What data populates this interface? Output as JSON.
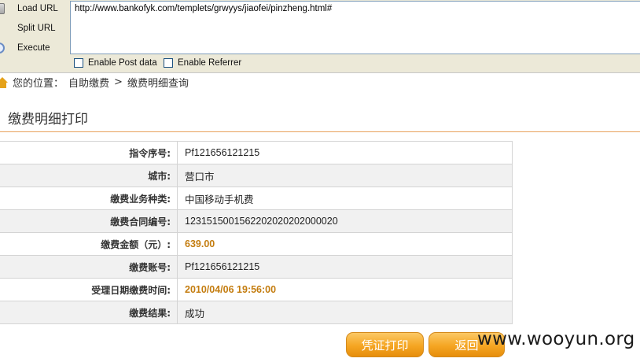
{
  "hackbar": {
    "load_url": "Load URL",
    "split_url": "Split URL",
    "execute": "Execute",
    "url_value": "http://www.bankofyk.com/templets/grwyys/jiaofei/pinzheng.html#",
    "enable_post": "Enable Post data",
    "enable_referrer": "Enable Referrer"
  },
  "breadcrumb": {
    "prefix": "您的位置：",
    "level1": "自助缴费",
    "sep": ">",
    "level2": "缴费明细查询"
  },
  "page_title": "缴费明细打印",
  "details": [
    {
      "label": "指令序号:",
      "value": "Pf121656121215"
    },
    {
      "label": "城市:",
      "value": "营口市"
    },
    {
      "label": "缴费业务种类:",
      "value": "中国移动手机费"
    },
    {
      "label": "缴费合同编号:",
      "value": "1231515001562202020202000020"
    },
    {
      "label": "缴费金额（元）:",
      "value": "639.00"
    },
    {
      "label": "缴费账号:",
      "value": "Pf121656121215"
    },
    {
      "label": "受理日期缴费时间:",
      "value": "2010/04/06 19:56:00"
    },
    {
      "label": "缴费结果:",
      "value": "成功"
    }
  ],
  "buttons": {
    "print": "凭证打印",
    "back": "返回"
  },
  "watermark": "www.wooyun.org",
  "colors": {
    "accent_orange": "#f5a623",
    "highlight_value": "#c47d10",
    "title_line": "#e8a15c"
  }
}
